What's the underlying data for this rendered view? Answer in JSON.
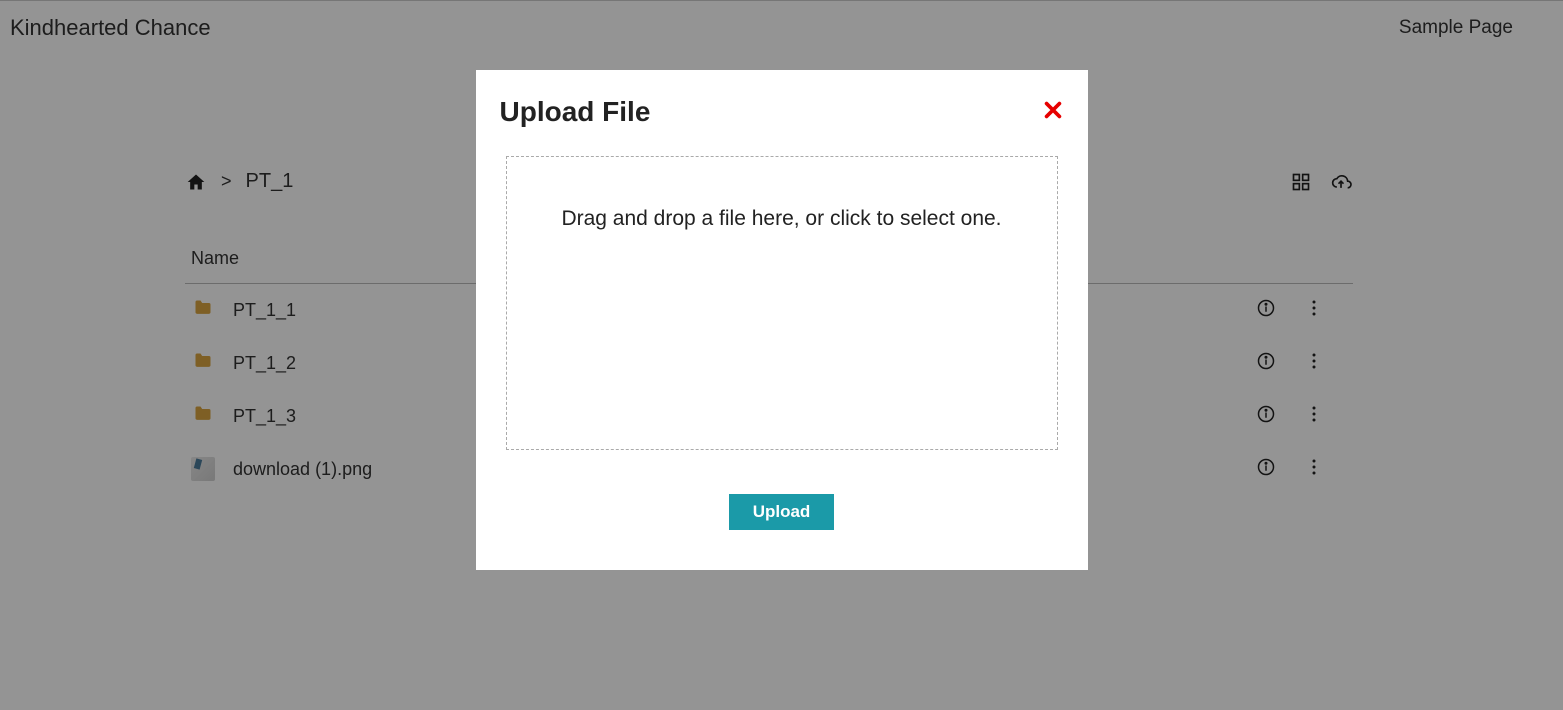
{
  "header": {
    "site_title": "Kindhearted Chance",
    "nav_link": "Sample Page"
  },
  "breadcrumb": {
    "separator": ">",
    "current": "PT_1"
  },
  "table": {
    "header_name": "Name"
  },
  "files": [
    {
      "name": "PT_1_1",
      "type": "folder"
    },
    {
      "name": "PT_1_2",
      "type": "folder"
    },
    {
      "name": "PT_1_3",
      "type": "folder"
    },
    {
      "name": "download (1).png",
      "type": "image"
    }
  ],
  "modal": {
    "title": "Upload File",
    "dropzone_text": "Drag and drop a file here, or click to select one.",
    "upload_button": "Upload"
  },
  "icons": {
    "home": "home-icon",
    "grid": "grid-icon",
    "cloud_upload": "cloud-upload-icon",
    "info": "info-icon",
    "kebab": "kebab-icon",
    "close": "close-icon",
    "folder": "folder-icon"
  },
  "colors": {
    "accent": "#1b9aa8",
    "close_red": "#e60000",
    "folder": "#d9a441"
  }
}
